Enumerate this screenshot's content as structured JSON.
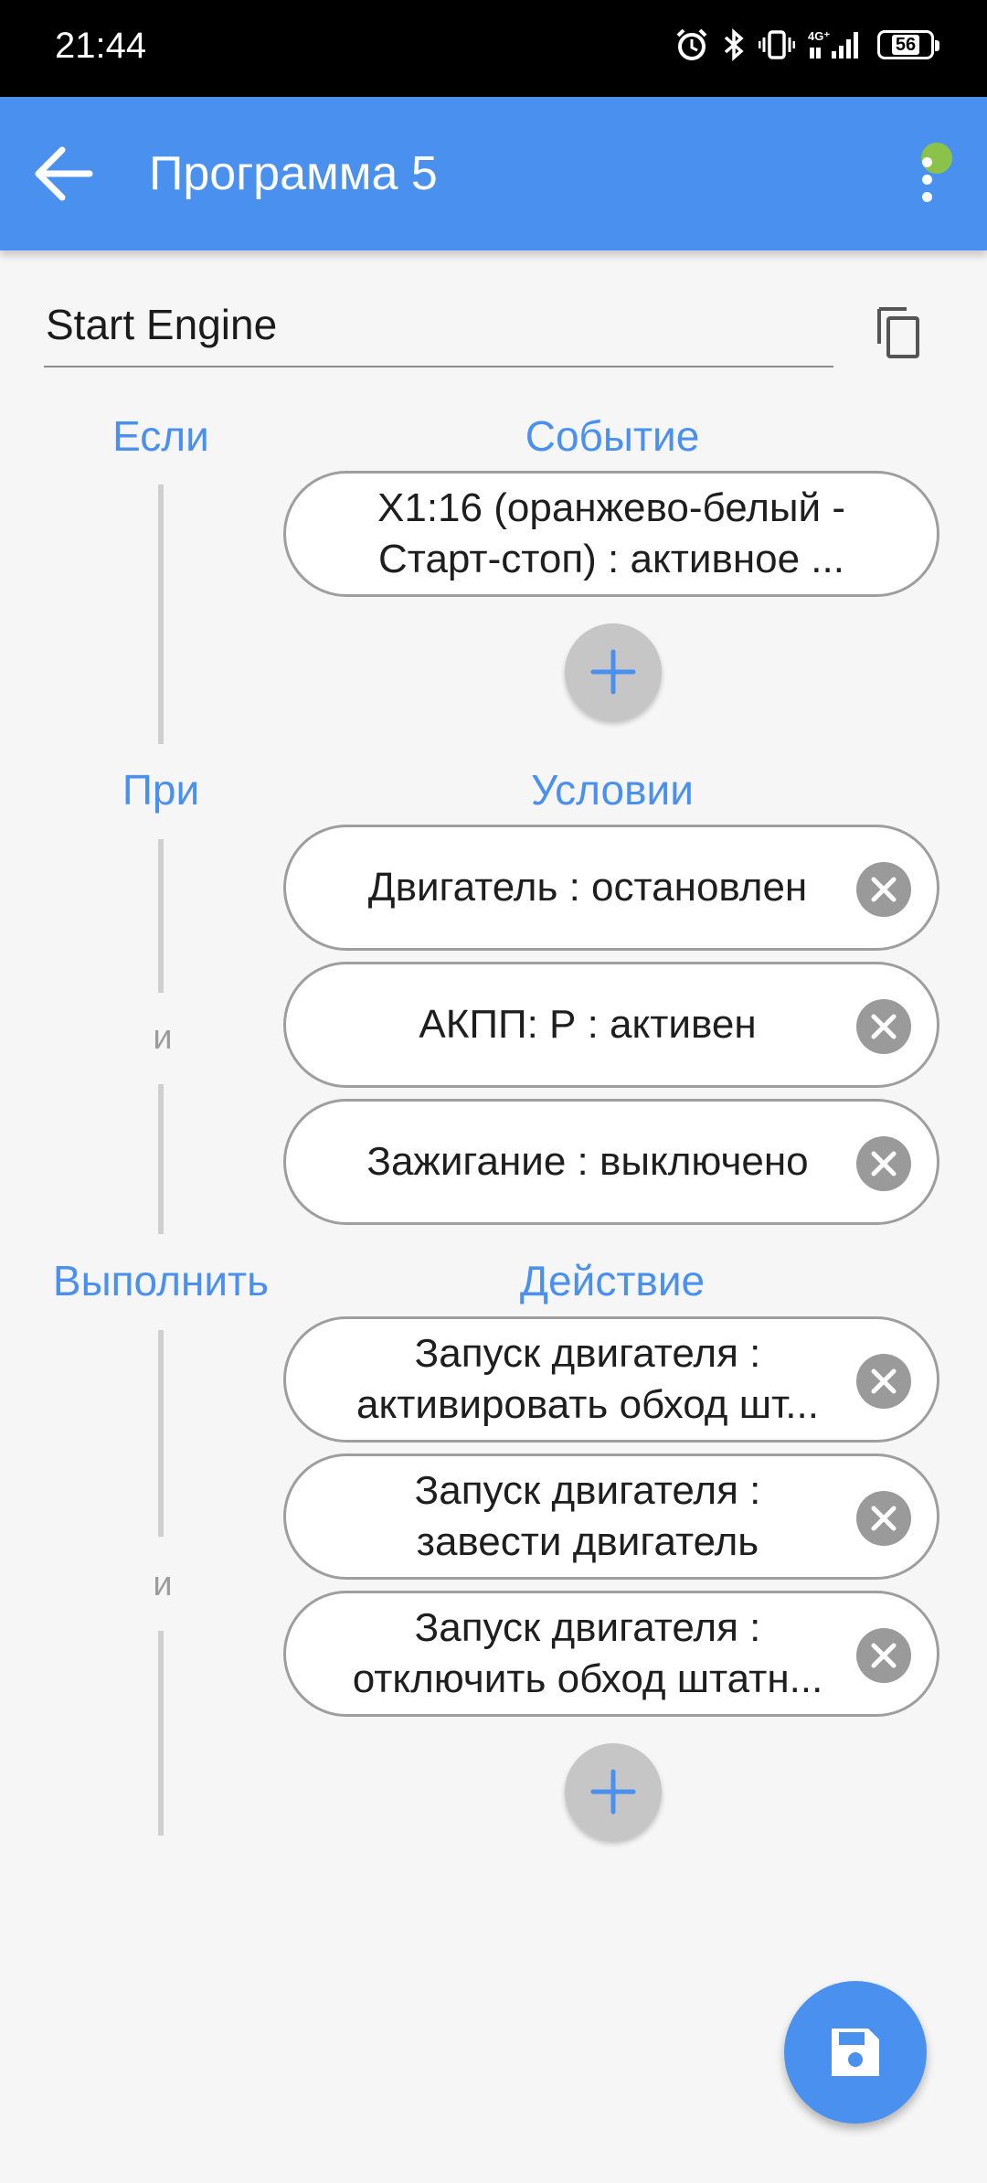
{
  "status_bar": {
    "time": "21:44",
    "battery": "56",
    "icons": [
      "alarm-icon",
      "bluetooth-icon",
      "vibrate-icon",
      "signal-4g-icon",
      "battery-icon"
    ]
  },
  "app_bar": {
    "title": "Программа 5",
    "back_icon": "arrow-left-icon",
    "menu_icon": "more-vert-icon",
    "status_dot_color": "#8bc34a",
    "color": "#4a90ef"
  },
  "program": {
    "name": "Start Engine",
    "copy_icon": "copy-icon"
  },
  "event_section": {
    "left_label": "Если",
    "right_label": "Событие",
    "items": [
      {
        "line1": "X1:16 (оранжево-белый -",
        "line2": "Старт-стоп) : активное ..."
      }
    ]
  },
  "condition_section": {
    "left_label": "При",
    "right_label": "Условии",
    "items": [
      {
        "label": "Двигатель : остановлен"
      },
      {
        "label": "АКПП: Р : активен"
      },
      {
        "label": "Зажигание : выключено"
      }
    ],
    "joiner": "и"
  },
  "action_section": {
    "left_label": "Выполнить",
    "right_label": "Действие",
    "items": [
      {
        "line1": "Запуск двигателя :",
        "line2": "активировать обход шт..."
      },
      {
        "line1": "Запуск двигателя :",
        "line2": "завести двигатель"
      },
      {
        "line1": "Запуск двигателя :",
        "line2": "отключить обход штатн..."
      }
    ],
    "joiner": "и"
  },
  "fab": {
    "icon": "save-icon"
  },
  "colors": {
    "accent": "#4a90ef",
    "background": "#f6f6f6"
  }
}
